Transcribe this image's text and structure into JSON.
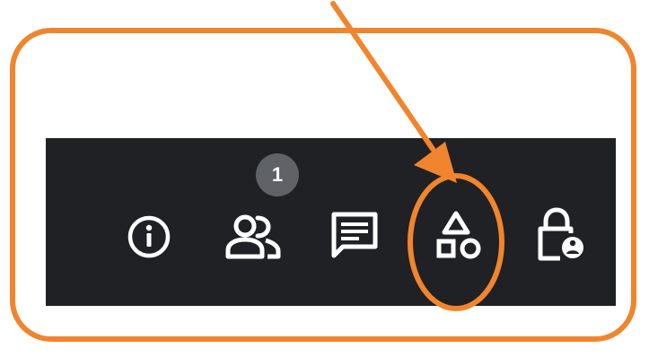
{
  "toolbar": {
    "people_badge_count": "1",
    "buttons": [
      {
        "name": "info-icon"
      },
      {
        "name": "people-icon"
      },
      {
        "name": "chat-icon"
      },
      {
        "name": "activities-icon"
      },
      {
        "name": "host-controls-lock-icon"
      }
    ]
  },
  "annotation": {
    "color": "#f0852d",
    "highlighted": "activities-icon"
  },
  "colors": {
    "toolbar_bg": "#202124",
    "icon": "#ffffff",
    "badge_bg": "#5f6368"
  }
}
